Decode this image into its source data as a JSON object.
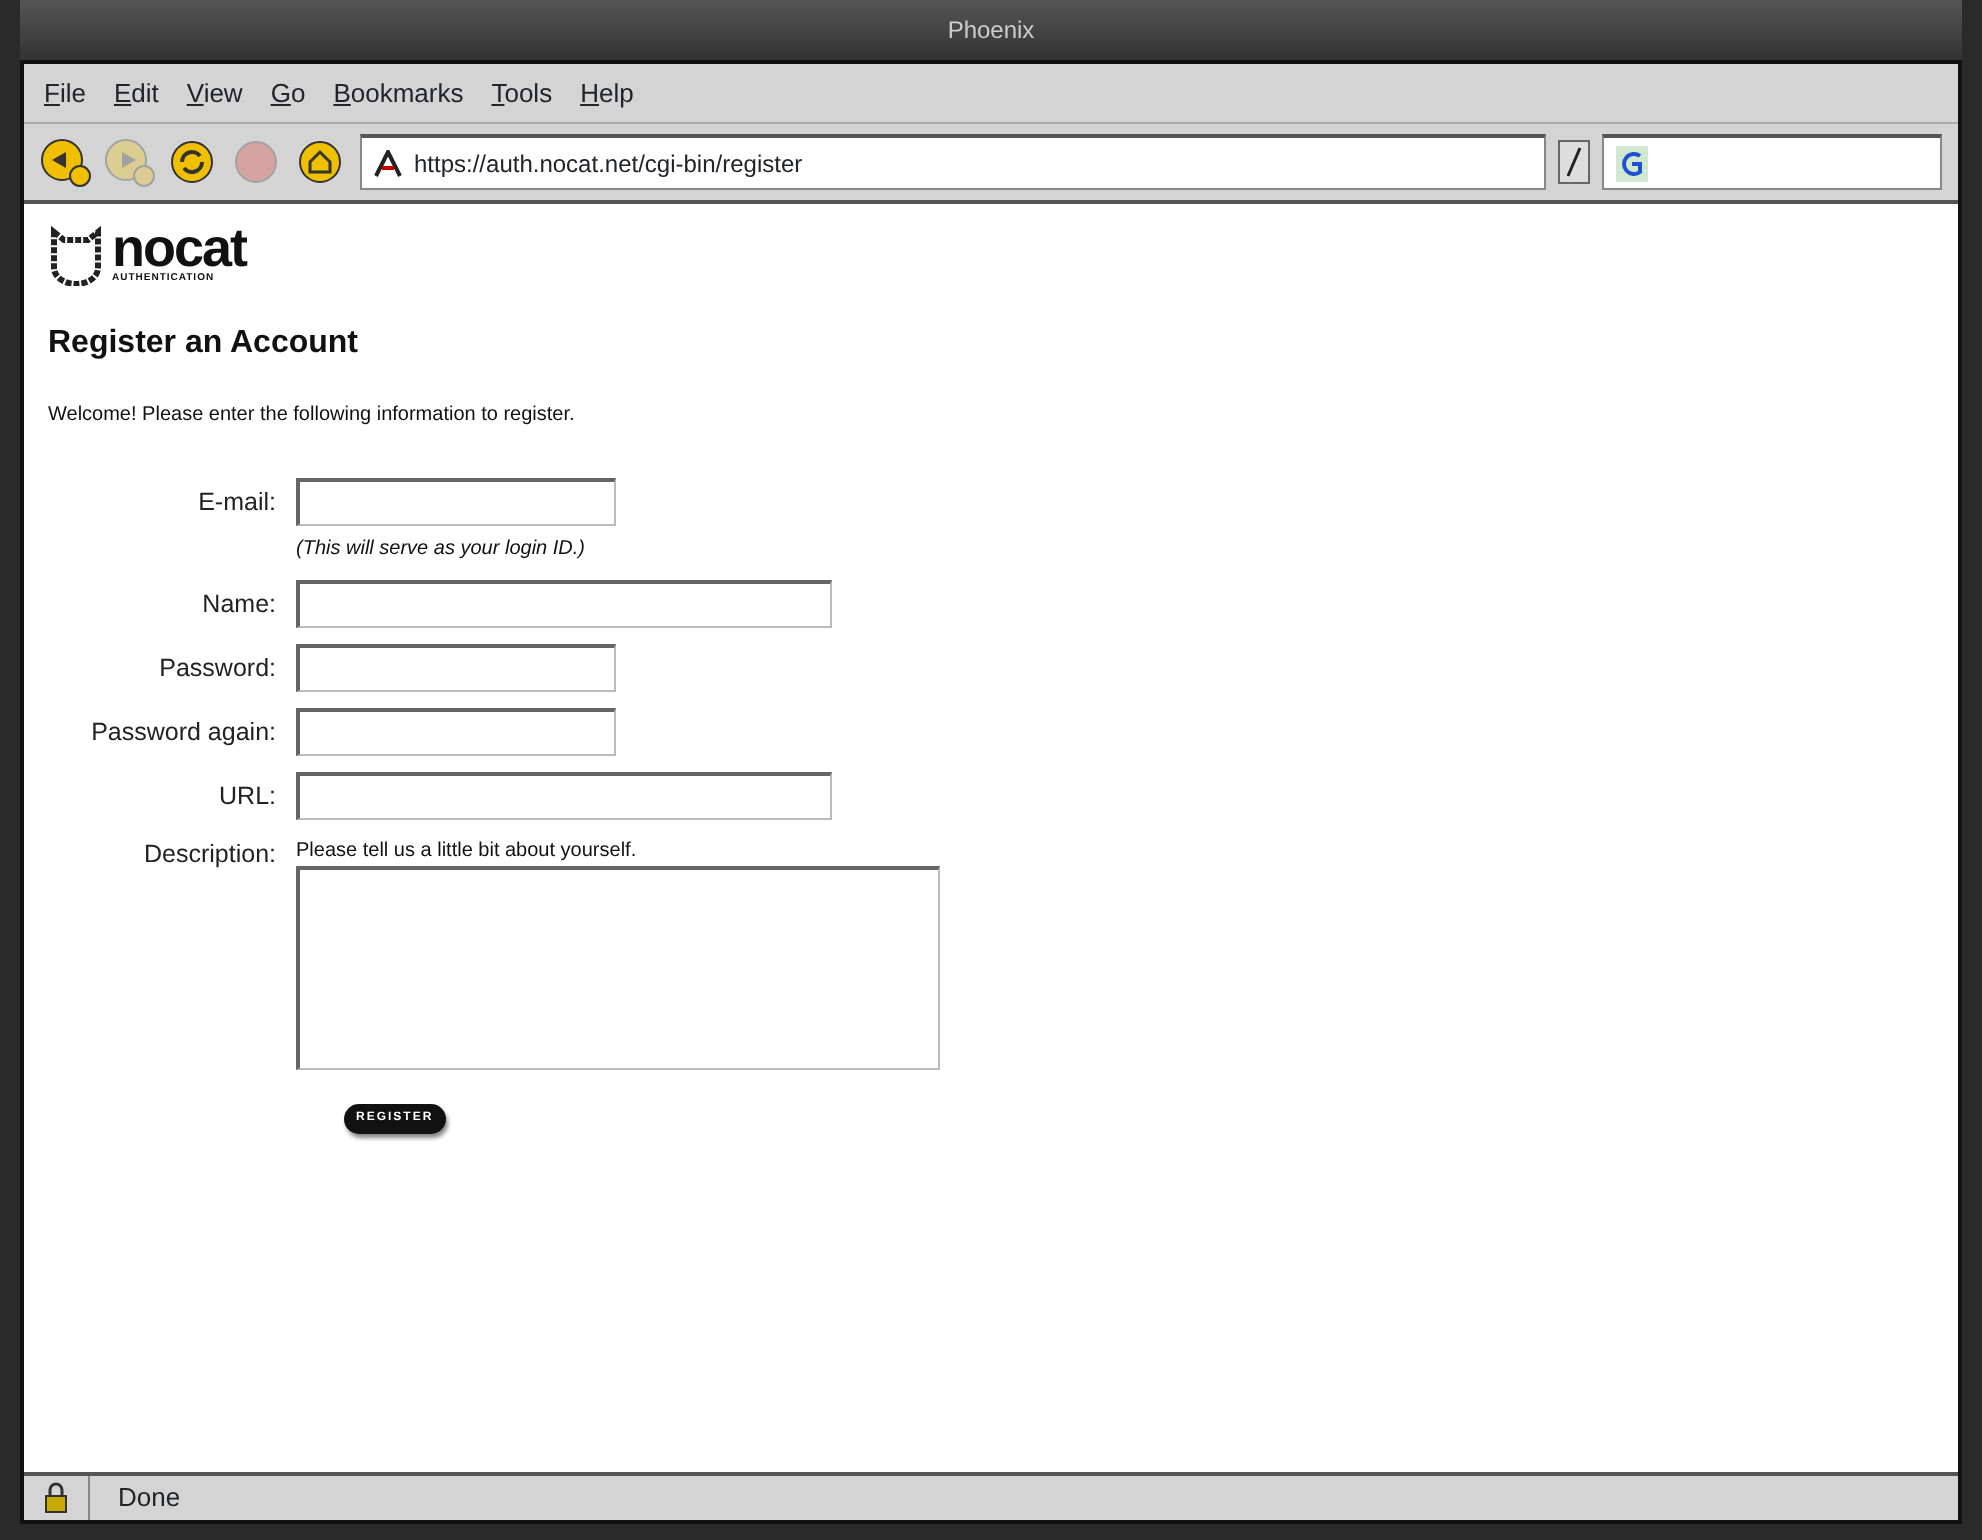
{
  "window": {
    "title": "Phoenix"
  },
  "menu": [
    "File",
    "Edit",
    "View",
    "Go",
    "Bookmarks",
    "Tools",
    "Help"
  ],
  "toolbar": {
    "buttons": [
      {
        "kind": "back",
        "disabled": false
      },
      {
        "kind": "forward",
        "disabled": true
      },
      {
        "kind": "reload",
        "disabled": false
      },
      {
        "kind": "stop",
        "disabled": true
      },
      {
        "kind": "home",
        "disabled": false
      }
    ],
    "address": "https://auth.nocat.net/cgi-bin/register"
  },
  "page": {
    "logo": {
      "name": "nocat",
      "tagline": "AUTHENTICATION"
    },
    "heading": "Register an Account",
    "intro": "Welcome! Please enter the following information to register.",
    "fields": [
      {
        "label": "E-mail:",
        "kind": "short",
        "note": "(This will serve as your login ID.)"
      },
      {
        "label": "Name:",
        "kind": "long"
      },
      {
        "label": "Password:",
        "kind": "short"
      },
      {
        "label": "Password again:",
        "kind": "short"
      },
      {
        "label": "URL:",
        "kind": "long"
      },
      {
        "label": "Description:",
        "kind": "area",
        "hint": "Please tell us a little bit about yourself."
      }
    ],
    "submit": "REGISTER"
  },
  "status_bar": {
    "text": "Done"
  }
}
